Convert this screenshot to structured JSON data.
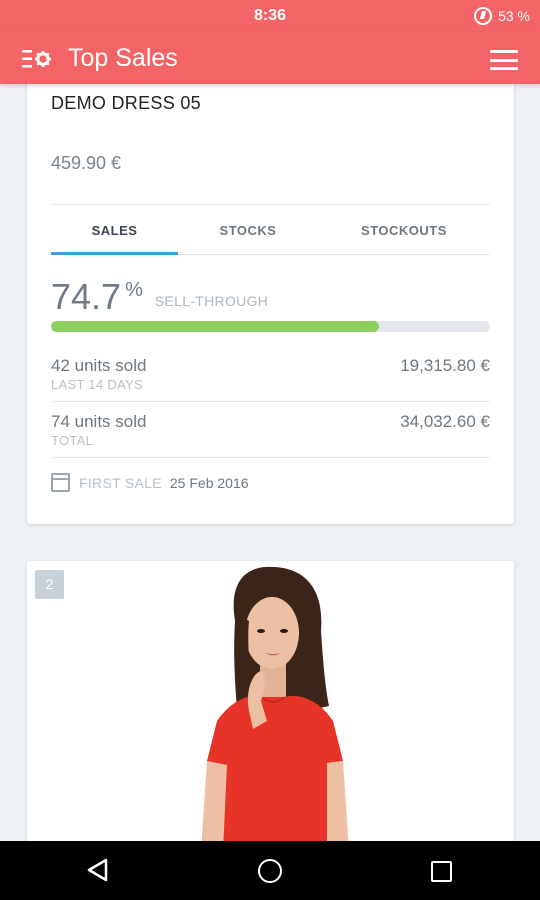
{
  "status_bar": {
    "time": "8:36",
    "battery_text": "53 %",
    "background": "#f36466"
  },
  "app_bar": {
    "title": "Top Sales",
    "left_icon": "filter-settings-icon",
    "right_icon": "hamburger-menu-icon",
    "color": "#f36466"
  },
  "product": {
    "name": "DEMO DRESS 05",
    "price": "459.90 €"
  },
  "tabs": [
    {
      "label": "SALES",
      "active": true
    },
    {
      "label": "STOCKS",
      "active": false
    },
    {
      "label": "STOCKOUTS",
      "active": false
    }
  ],
  "sell_through": {
    "value": "74.7",
    "unit": "%",
    "label": "SELL-THROUGH",
    "progress_fraction": 0.747,
    "bar_color": "#8ccf5c"
  },
  "stats": [
    {
      "units": "42 units sold",
      "period": "LAST 14 DAYS",
      "amount": "19,315.80 €"
    },
    {
      "units": "74 units sold",
      "period": "TOTAL",
      "amount": "34,032.60 €"
    }
  ],
  "first_sale": {
    "label": "FIRST SALE",
    "date": "25 Feb 2016",
    "icon": "calendar-icon"
  },
  "next_item": {
    "rank": "2",
    "image": "model-red-dress"
  },
  "nav_bar": {
    "back_icon": "back-triangle-icon",
    "home_icon": "home-circle-icon",
    "recent_icon": "recent-apps-square-icon"
  }
}
